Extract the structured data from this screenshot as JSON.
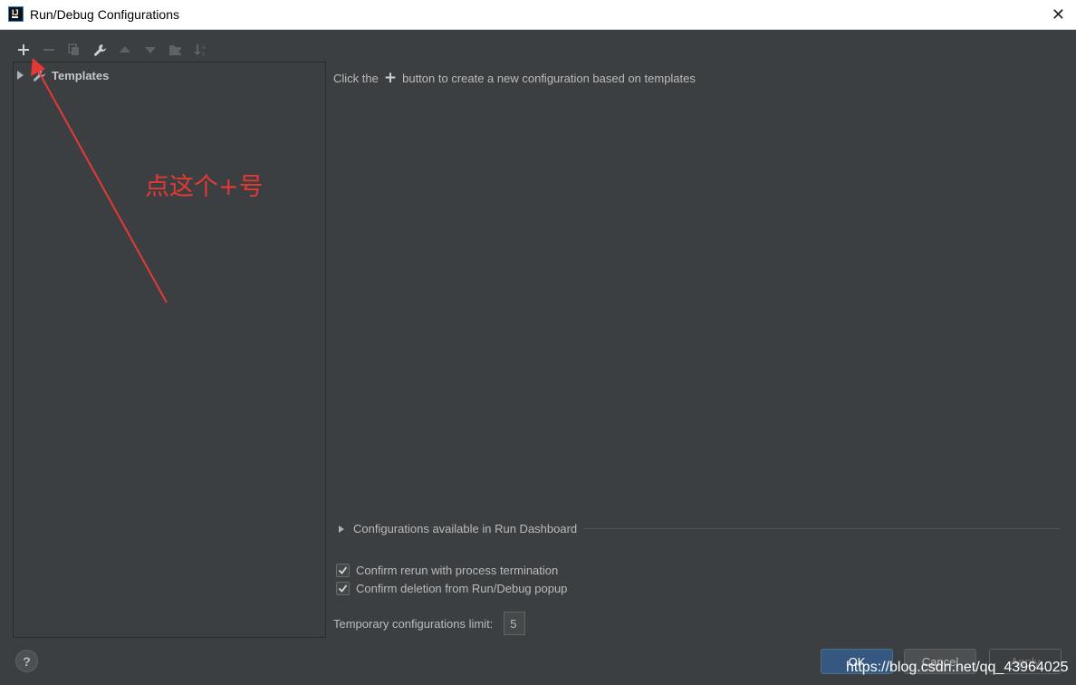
{
  "window": {
    "title": "Run/Debug Configurations",
    "close_glyph": "✕"
  },
  "toolbar": {
    "buttons": [
      {
        "icon": "plus-icon",
        "enabled": true
      },
      {
        "icon": "minus-icon",
        "enabled": false
      },
      {
        "icon": "copy-icon",
        "enabled": false
      },
      {
        "icon": "wrench-icon",
        "enabled": true
      },
      {
        "icon": "arrow-up-icon",
        "enabled": false
      },
      {
        "icon": "arrow-down-icon",
        "enabled": false
      },
      {
        "icon": "folder-add-icon",
        "enabled": false
      },
      {
        "icon": "sort-icon",
        "enabled": false
      }
    ]
  },
  "tree": {
    "items": [
      {
        "label": "Templates",
        "icon": "wrench-icon",
        "expanded": false
      }
    ]
  },
  "main": {
    "hint_prefix": "Click the",
    "hint_plus": "+",
    "hint_suffix": "button to create a new configuration based on templates",
    "dashboard_label": "Configurations available in Run Dashboard",
    "checkboxes": [
      {
        "label": "Confirm rerun with process termination",
        "checked": true
      },
      {
        "label": "Confirm deletion from Run/Debug popup",
        "checked": true
      }
    ],
    "limit_label": "Temporary configurations limit:",
    "limit_value": "5"
  },
  "footer": {
    "help": "?",
    "ok": "OK",
    "cancel": "Cancel",
    "apply": "Apply"
  },
  "annotation": {
    "text": "点这个+号",
    "color": "#e53935"
  },
  "watermark": "https://blog.csdn.net/qq_43964025",
  "colors": {
    "background": "#3c3f41",
    "accent": "#365880"
  }
}
